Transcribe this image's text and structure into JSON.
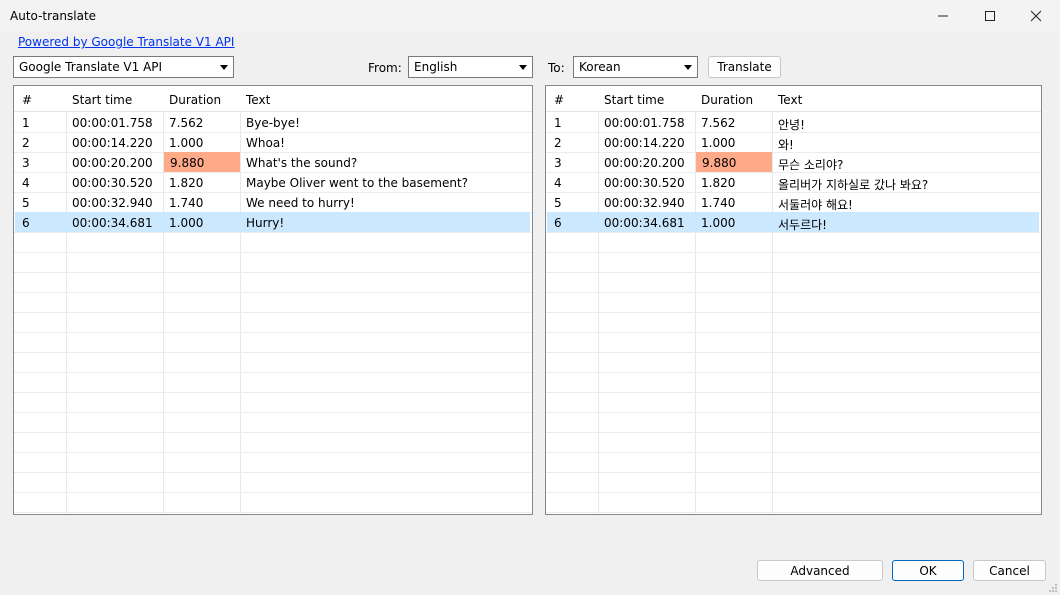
{
  "window": {
    "title": "Auto-translate"
  },
  "link_text": "Powered by Google Translate V1 API",
  "engine": {
    "value": "Google Translate V1 API"
  },
  "from": {
    "label": "From:",
    "value": "English"
  },
  "to": {
    "label": "To:",
    "value": "Korean"
  },
  "translate_label": "Translate",
  "columns": [
    "#",
    "Start time",
    "Duration",
    "Text"
  ],
  "source_rows": [
    {
      "num": "1",
      "start": "00:00:01.758",
      "duration": "7.562",
      "text": "Bye-bye!"
    },
    {
      "num": "2",
      "start": "00:00:14.220",
      "duration": "1.000",
      "text": "Whoa!"
    },
    {
      "num": "3",
      "start": "00:00:20.200",
      "duration": "9.880",
      "text": "What's the sound?"
    },
    {
      "num": "4",
      "start": "00:00:30.520",
      "duration": "1.820",
      "text": "Maybe Oliver went to the basement?"
    },
    {
      "num": "5",
      "start": "00:00:32.940",
      "duration": "1.740",
      "text": "We need to hurry!"
    },
    {
      "num": "6",
      "start": "00:00:34.681",
      "duration": "1.000",
      "text": "Hurry!"
    }
  ],
  "target_rows": [
    {
      "num": "1",
      "start": "00:00:01.758",
      "duration": "7.562",
      "text": "안녕!"
    },
    {
      "num": "2",
      "start": "00:00:14.220",
      "duration": "1.000",
      "text": "와!"
    },
    {
      "num": "3",
      "start": "00:00:20.200",
      "duration": "9.880",
      "text": "무슨 소리야?"
    },
    {
      "num": "4",
      "start": "00:00:30.520",
      "duration": "1.820",
      "text": "올리버가 지하실로 갔나 봐요?"
    },
    {
      "num": "5",
      "start": "00:00:32.940",
      "duration": "1.740",
      "text": "서둘러야 해요!"
    },
    {
      "num": "6",
      "start": "00:00:34.681",
      "duration": "1.000",
      "text": "서두르다!"
    }
  ],
  "warn_row_index": 2,
  "selected_row_index": 5,
  "buttons": {
    "advanced": "Advanced",
    "ok": "OK",
    "cancel": "Cancel"
  },
  "colors": {
    "selection": "#cce8ff",
    "duration_warning": "#ffab8a",
    "link": "#0033ee",
    "primary_border": "#0067c0"
  },
  "icons": {
    "minimize": "minimize-icon",
    "maximize": "maximize-icon",
    "close": "close-icon",
    "dropdown": "chevron-down-icon",
    "resize": "resize-grip-icon"
  }
}
